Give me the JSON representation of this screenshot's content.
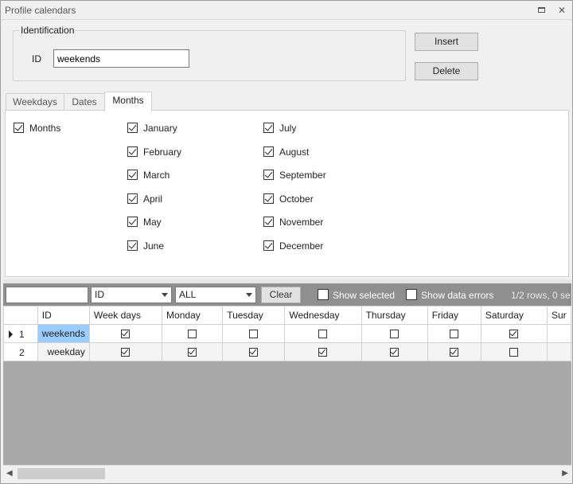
{
  "window": {
    "title": "Profile calendars",
    "restore_icon": "restore-icon",
    "close_glyph": "✕"
  },
  "identification": {
    "legend": "Identification",
    "id_label": "ID",
    "id_value": "weekends"
  },
  "actions": {
    "insert_label": "Insert",
    "delete_label": "Delete"
  },
  "tabs": [
    {
      "label": "Weekdays",
      "active": false
    },
    {
      "label": "Dates",
      "active": false
    },
    {
      "label": "Months",
      "active": true
    }
  ],
  "months_panel": {
    "all_label": "Months",
    "all_checked": true,
    "col1": [
      {
        "label": "January",
        "checked": true
      },
      {
        "label": "February",
        "checked": true
      },
      {
        "label": "March",
        "checked": true
      },
      {
        "label": "April",
        "checked": true
      },
      {
        "label": "May",
        "checked": true
      },
      {
        "label": "June",
        "checked": true
      }
    ],
    "col2": [
      {
        "label": "July",
        "checked": true
      },
      {
        "label": "August",
        "checked": true
      },
      {
        "label": "September",
        "checked": true
      },
      {
        "label": "October",
        "checked": true
      },
      {
        "label": "November",
        "checked": true
      },
      {
        "label": "December",
        "checked": true
      }
    ]
  },
  "toolbar": {
    "filter_value": "",
    "column_select": "ID",
    "scope_select": "ALL",
    "clear_label": "Clear",
    "show_selected_label": "Show selected",
    "show_data_errors_label": "Show data errors",
    "row_info": "1/2 rows, 0 se"
  },
  "grid": {
    "columns": [
      "ID",
      "Week days",
      "Monday",
      "Tuesday",
      "Wednesday",
      "Thursday",
      "Friday",
      "Saturday",
      "Sur"
    ],
    "rows": [
      {
        "num": "1",
        "current": true,
        "id": "weekends",
        "flags": [
          true,
          false,
          false,
          false,
          false,
          false,
          true
        ]
      },
      {
        "num": "2",
        "current": false,
        "id": "weekday",
        "flags": [
          true,
          true,
          true,
          true,
          true,
          true,
          false
        ]
      }
    ]
  }
}
